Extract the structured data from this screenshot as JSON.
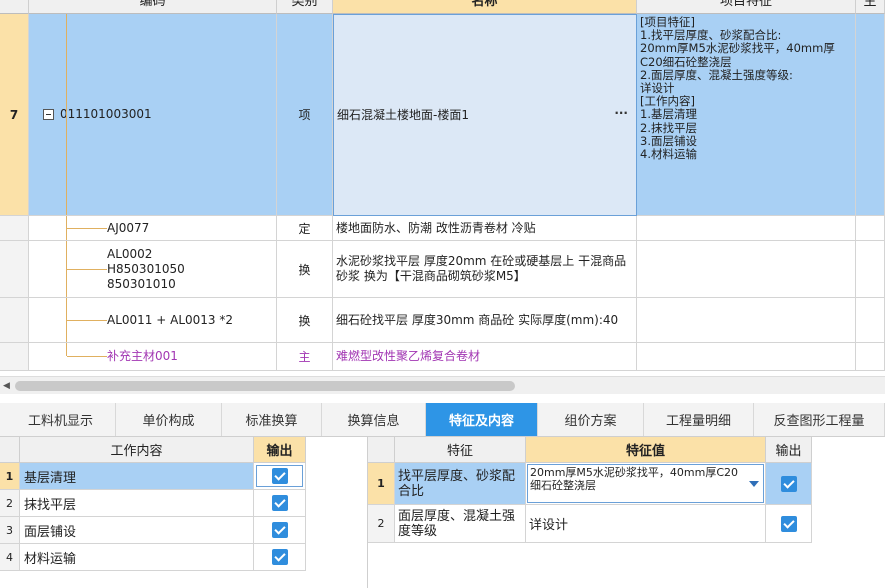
{
  "main_grid": {
    "headers": {
      "code": "编码",
      "kind": "类别",
      "name": "名称",
      "feature": "项目特征",
      "extra": "主"
    },
    "row7": {
      "num": "7",
      "code": "011101003001",
      "kind": "项",
      "name": "细石混凝土楼地面-楼面1",
      "name_dots": "···",
      "feature_lines": [
        "[项目特征]",
        "1.找平层厚度、砂浆配合比:",
        "20mm厚M5水泥砂浆找平，40mm厚",
        "C20细石砼整浇层",
        "2.面层厚度、混凝土强度等级:",
        "详设计",
        "[工作内容]",
        "1.基层清理",
        "2.抹找平层",
        "3.面层铺设",
        "4.材料运输"
      ]
    },
    "rows": [
      {
        "code": "AJ0077",
        "kind": "定",
        "name": "楼地面防水、防潮 改性沥青卷材 冷贴"
      },
      {
        "code": "AL0002 H850301050 850301010",
        "kind": "换",
        "name": "水泥砂浆找平层 厚度20mm 在砼或硬基层上 干混商品砂浆  换为【干混商品砌筑砂浆M5】"
      },
      {
        "code": "AL0011 + AL0013 *2",
        "kind": "换",
        "name": "细石砼找平层 厚度30mm 商品砼  实际厚度(mm):40"
      },
      {
        "code": "补充主材001",
        "kind": "主",
        "name": "难燃型改性聚乙烯复合卷材"
      }
    ]
  },
  "tabs": [
    {
      "label": "工料机显示"
    },
    {
      "label": "单价构成"
    },
    {
      "label": "标准换算"
    },
    {
      "label": "换算信息"
    },
    {
      "label": "特征及内容"
    },
    {
      "label": "组价方案"
    },
    {
      "label": "工程量明细"
    },
    {
      "label": "反查图形工程量"
    }
  ],
  "work_grid": {
    "headers": {
      "content": "工作内容",
      "output": "输出"
    },
    "rows": [
      {
        "num": "1",
        "content": "基层清理"
      },
      {
        "num": "2",
        "content": "抹找平层"
      },
      {
        "num": "3",
        "content": "面层铺设"
      },
      {
        "num": "4",
        "content": "材料运输"
      }
    ]
  },
  "feature_grid": {
    "headers": {
      "feature": "特征",
      "value": "特征值",
      "output": "输出"
    },
    "rows": [
      {
        "num": "1",
        "feature": "找平层厚度、砂浆配合比",
        "value": "20mm厚M5水泥砂浆找平，40mm厚C20细石砼整浇层"
      },
      {
        "num": "2",
        "feature": "面层厚度、混凝土强度等级",
        "value": "详设计"
      }
    ]
  },
  "colors": {
    "selection": "#a9d0f4",
    "header_selected": "#fbe1a8",
    "tab_active": "#2e95e6",
    "main_material": "#a236b3"
  }
}
